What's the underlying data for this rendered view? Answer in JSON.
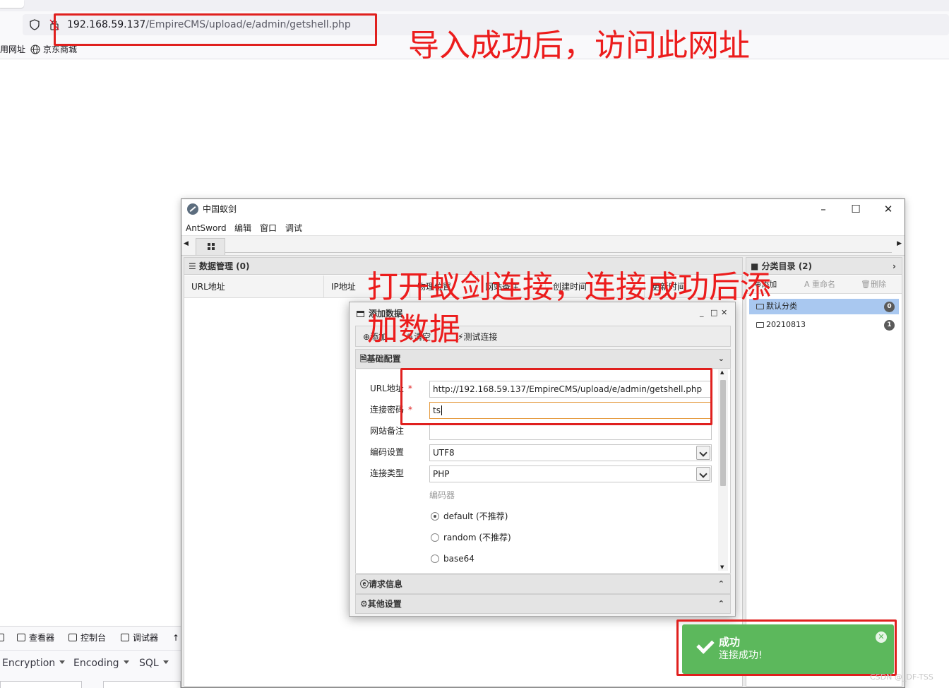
{
  "browser": {
    "url_host": "192.168.59.137",
    "url_path": "/EmpireCMS/upload/e/admin/getshell.php",
    "bookmarks": [
      "用网址",
      "京东商城"
    ]
  },
  "devtools": {
    "tabs": [
      "查看器",
      "控制台",
      "调试器",
      "↑"
    ],
    "menus": [
      "Encryption",
      "Encoding",
      "SQL"
    ]
  },
  "annotations": {
    "top": "导入成功后，访问此网址",
    "middle_line1": "打开蚁剑连接，连接成功后添",
    "middle_line2": "加数据"
  },
  "antsword": {
    "title": "中国蚁剑",
    "window_controls": [
      "–",
      "☐",
      "✕"
    ],
    "menu": [
      "AntSword",
      "编辑",
      "窗口",
      "调试"
    ],
    "data_panel": {
      "title": "数据管理 (0)",
      "columns": [
        "URL地址",
        "IP地址",
        "物理位置",
        "网站备注",
        "创建时间",
        "更新时间"
      ]
    },
    "category_panel": {
      "title": "分类目录 (2)",
      "tools": [
        "添加",
        "重命名",
        "删除"
      ],
      "items": [
        {
          "label": "默认分类",
          "count": "0"
        },
        {
          "label": "20210813",
          "count": "1"
        }
      ]
    },
    "dialog": {
      "title": "添加数据",
      "toolbar": [
        "添加",
        "清空",
        "测试连接"
      ],
      "sections": {
        "basic": "基础配置",
        "request": "请求信息",
        "other": "其他设置"
      },
      "fields": {
        "url_label": "URL地址",
        "url_value": "http://192.168.59.137/EmpireCMS/upload/e/admin/getshell.php",
        "password_label": "连接密码",
        "password_value": "ts",
        "note_label": "网站备注",
        "note_value": "",
        "encoding_label": "编码设置",
        "encoding_value": "UTF8",
        "type_label": "连接类型",
        "type_value": "PHP",
        "encoder_label": "编码器",
        "encoders": [
          "default (不推荐)",
          "random (不推荐)",
          "base64"
        ]
      }
    },
    "toast": {
      "title": "成功",
      "message": "连接成功!"
    }
  },
  "watermark": "CSDN @_DF-TSS",
  "colors": {
    "annotation_red": "#e0201e",
    "toast_green": "#5cb85c",
    "selected_row": "#a9c8f0"
  }
}
